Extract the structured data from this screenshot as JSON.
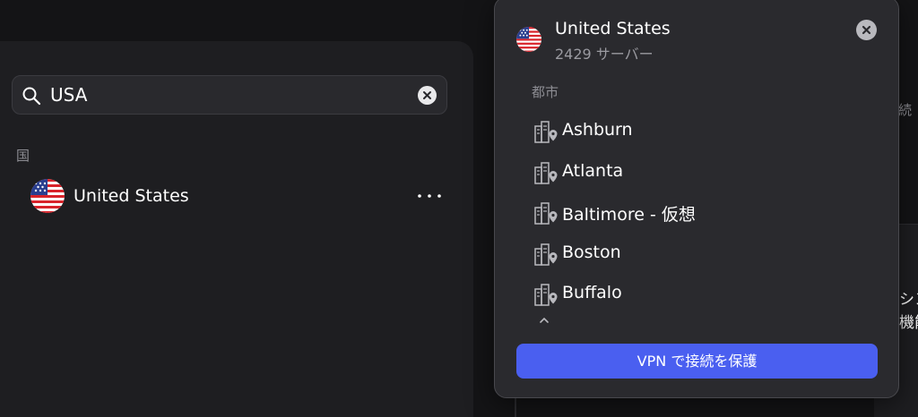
{
  "search": {
    "value": "USA",
    "placeholder": ""
  },
  "results": {
    "section_label": "国",
    "country": {
      "name": "United States",
      "more_label": "⋯"
    }
  },
  "popover": {
    "title": "United States",
    "subtitle": "2429 サーバー",
    "cities_label": "都市",
    "cities": [
      {
        "name": "Ashburn"
      },
      {
        "name": "Atlanta"
      },
      {
        "name": "Baltimore - 仮想"
      },
      {
        "name": "Boston"
      },
      {
        "name": "Buffalo"
      }
    ],
    "connect_label": "VPN で接続を保護"
  },
  "background": {
    "text_1": "続",
    "text_2_line1": "シン",
    "text_2_line2": "機能"
  },
  "colors": {
    "accent": "#4a5ff0",
    "panel": "#1e1e21",
    "popover": "#2a2a2e"
  }
}
